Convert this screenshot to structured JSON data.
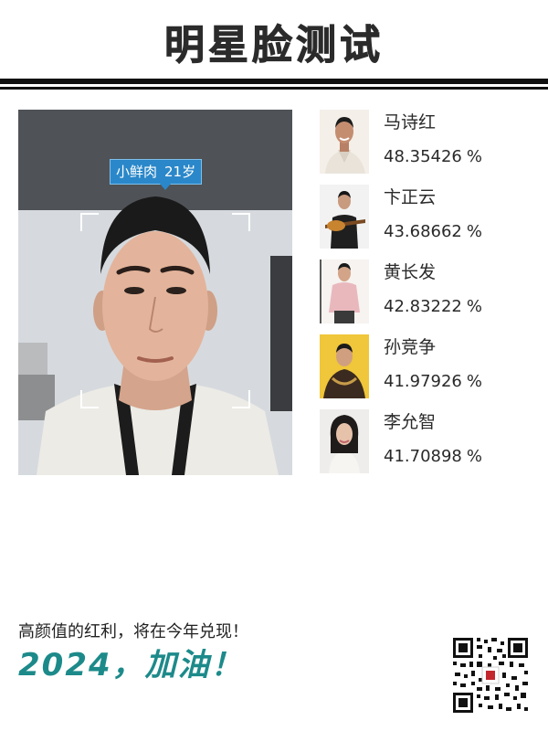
{
  "page": {
    "title": "明星脸测试",
    "accent_color": "#1d8a8a"
  },
  "photo": {
    "tag_label": "小鲜肉",
    "tag_age": "21岁",
    "tag_color": "#2a87c9"
  },
  "matches": [
    {
      "name": "马诗红",
      "score": "48.35426",
      "unit": "%"
    },
    {
      "name": "卞正云",
      "score": "43.68662",
      "unit": "%"
    },
    {
      "name": "黄长发",
      "score": "42.83222",
      "unit": "%"
    },
    {
      "name": "孙竞争",
      "score": "41.97926",
      "unit": "%"
    },
    {
      "name": "李允智",
      "score": "41.70898",
      "unit": "%"
    }
  ],
  "footer": {
    "slogan": "高颜值的红利，将在今年兑现！",
    "cheer": "2024，加油！"
  }
}
